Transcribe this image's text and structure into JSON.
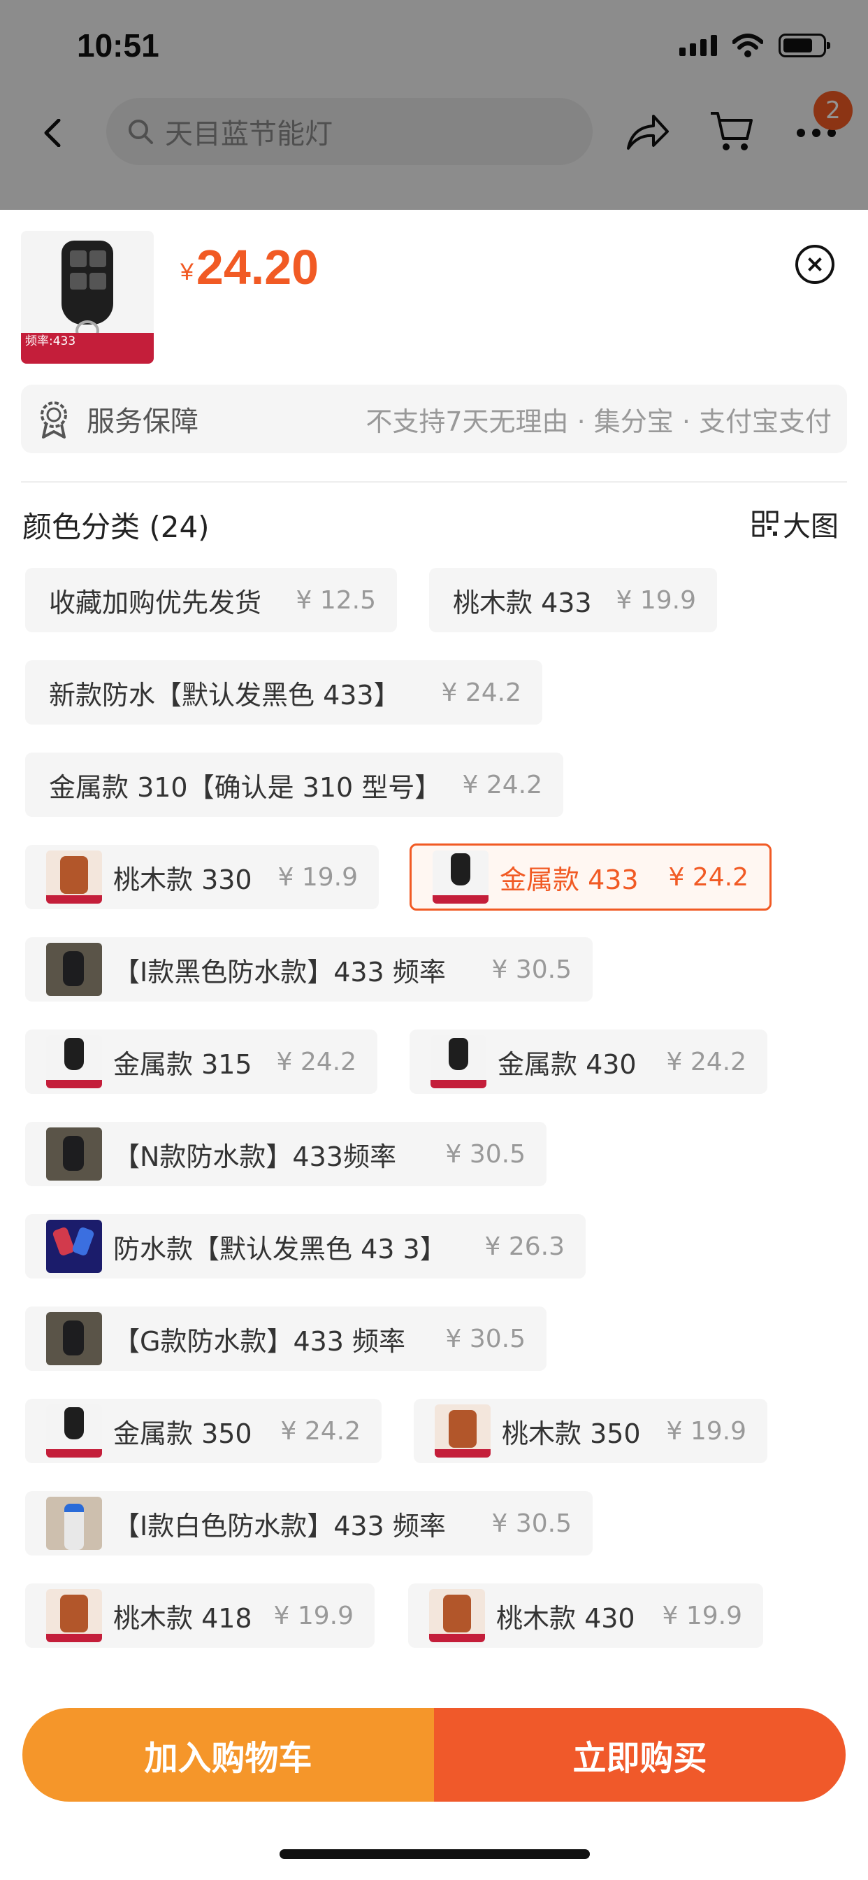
{
  "status_bar": {
    "time": "10:51"
  },
  "nav": {
    "search_placeholder": "天目蓝节能灯",
    "cart_badge": "2"
  },
  "product": {
    "currency": "¥",
    "price": "24.20",
    "thumb_tag": "频率:433"
  },
  "service": {
    "label": "服务保障",
    "value": "不支持7天无理由 · 集分宝 · 支付宝支付"
  },
  "variants": {
    "title": "颜色分类 (24)",
    "big_view": "大图",
    "selected": "金属款 433",
    "options": [
      {
        "name": "收藏加购优先发货",
        "price": "¥ 12.5",
        "thumb": ""
      },
      {
        "name": "桃木款 433",
        "price": "¥ 19.9",
        "thumb": ""
      },
      {
        "name": "新款防水【默认发黑色 433】",
        "price": "¥ 24.2",
        "thumb": ""
      },
      {
        "name": "金属款 310【确认是 310 型号】",
        "price": "¥ 24.2",
        "thumb": ""
      },
      {
        "name": "桃木款 330",
        "price": "¥ 19.9",
        "thumb": "wood"
      },
      {
        "name": "金属款 433",
        "price": "¥ 24.2",
        "thumb": "metal"
      },
      {
        "name": "【I款黑色防水款】433 频率",
        "price": "¥ 30.5",
        "thumb": "photo"
      },
      {
        "name": "金属款 315",
        "price": "¥ 24.2",
        "thumb": "metal"
      },
      {
        "name": "金属款 430",
        "price": "¥ 24.2",
        "thumb": "metal"
      },
      {
        "name": "【N款防水款】433频率",
        "price": "¥ 30.5",
        "thumb": "photo"
      },
      {
        "name": "防水款【默认发黑色 43 3】",
        "price": "¥ 26.3",
        "thumb": "blue"
      },
      {
        "name": "【G款防水款】433 频率",
        "price": "¥ 30.5",
        "thumb": "photo"
      },
      {
        "name": "金属款 350",
        "price": "¥ 24.2",
        "thumb": "metal"
      },
      {
        "name": "桃木款 350",
        "price": "¥ 19.9",
        "thumb": "wood"
      },
      {
        "name": "【I款白色防水款】433 频率",
        "price": "¥ 30.5",
        "thumb": "white"
      },
      {
        "name": "桃木款 418",
        "price": "¥ 19.9",
        "thumb": "wood"
      },
      {
        "name": "桃木款 430",
        "price": "¥ 19.9",
        "thumb": "wood"
      }
    ]
  },
  "actions": {
    "add_to_cart": "加入购物车",
    "buy_now": "立即购买"
  },
  "colors": {
    "accent": "#f15a24",
    "cart_button": "#f5962a",
    "buy_button": "#f0592a"
  }
}
